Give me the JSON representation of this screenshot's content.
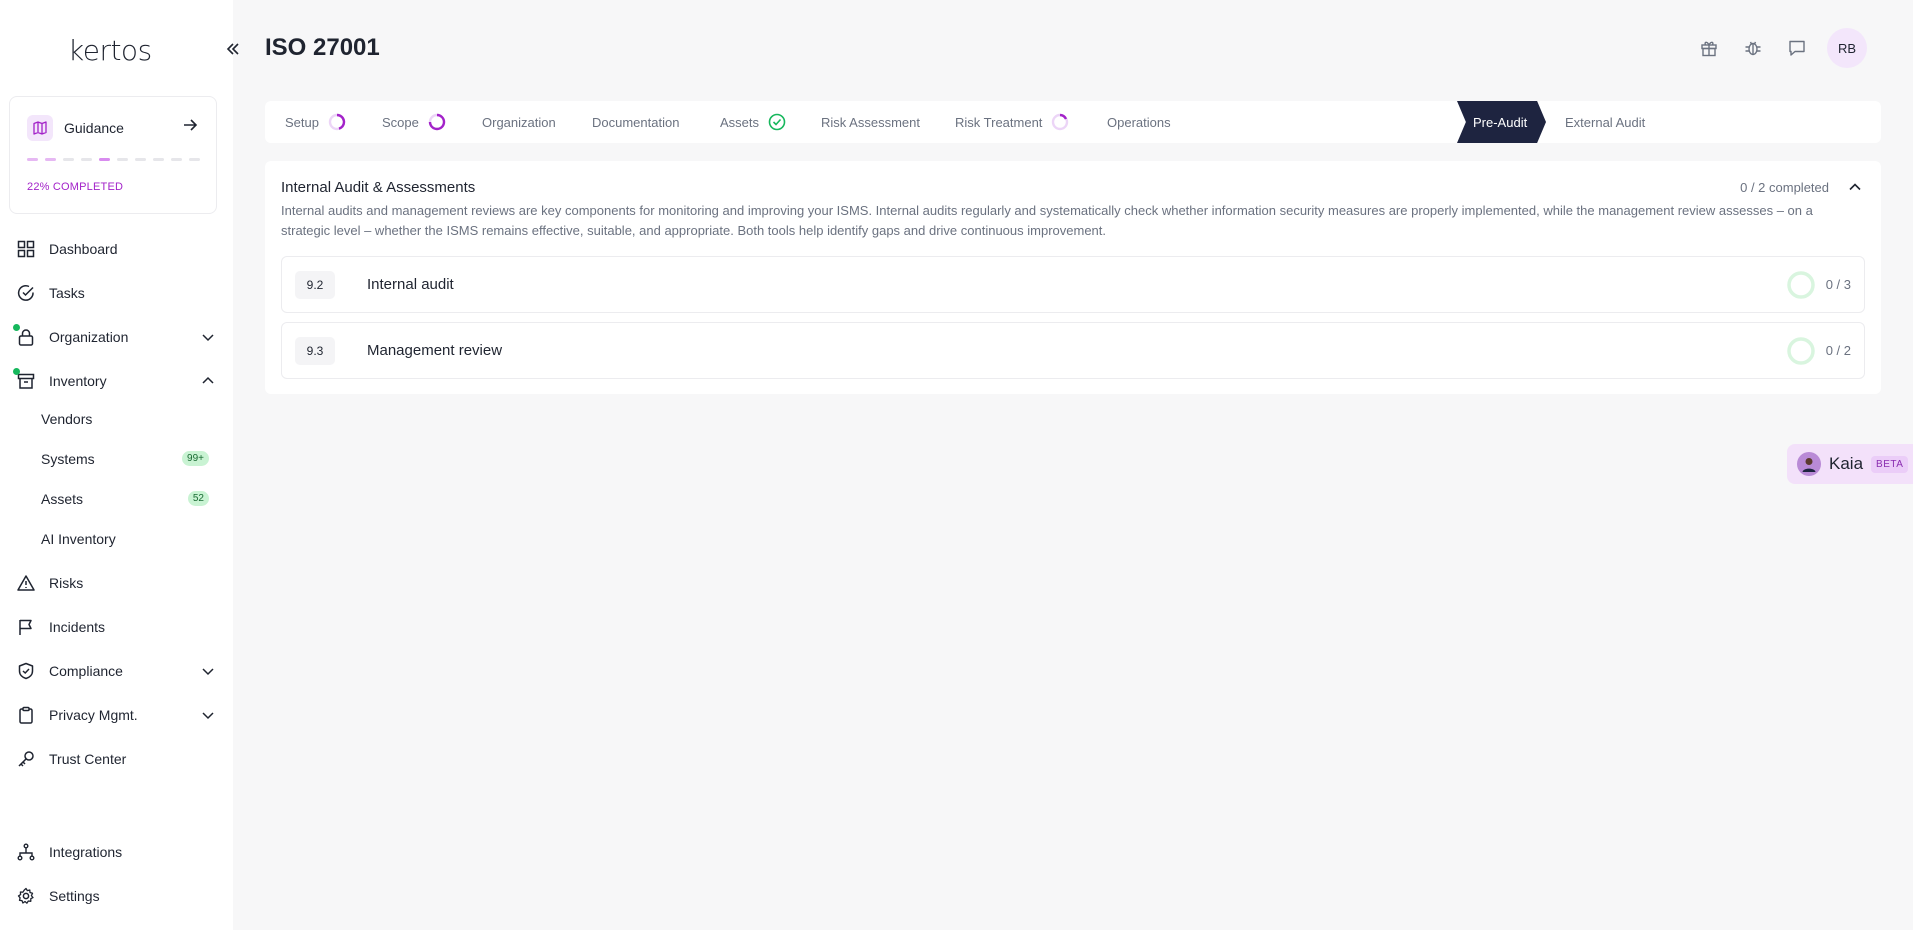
{
  "app": {
    "logo_text": "kertos",
    "page_title": "ISO 27001"
  },
  "sidebar": {
    "guidance": {
      "label": "Guidance",
      "progress_text": "22% COMPLETED",
      "progress_fraction": 0.22
    },
    "items": [
      {
        "label": "Dashboard",
        "icon": "grid-icon"
      },
      {
        "label": "Tasks",
        "icon": "check-circle-icon"
      },
      {
        "label": "Organization",
        "icon": "lock-icon",
        "has_dot": true,
        "expandable": true,
        "expanded": false
      },
      {
        "label": "Inventory",
        "icon": "archive-icon",
        "has_dot": true,
        "expandable": true,
        "expanded": true
      },
      {
        "label": "Risks",
        "icon": "warning-icon"
      },
      {
        "label": "Incidents",
        "icon": "flag-icon"
      },
      {
        "label": "Compliance",
        "icon": "shield-check-icon",
        "expandable": true,
        "expanded": false
      },
      {
        "label": "Privacy Mgmt.",
        "icon": "clipboard-icon",
        "expandable": true,
        "expanded": false
      },
      {
        "label": "Trust Center",
        "icon": "key-icon"
      },
      {
        "label": "Integrations",
        "icon": "network-icon"
      },
      {
        "label": "Settings",
        "icon": "gear-icon"
      }
    ],
    "inventory_sub": [
      {
        "label": "Vendors",
        "badge": ""
      },
      {
        "label": "Systems",
        "badge": "99+"
      },
      {
        "label": "Assets",
        "badge": "52"
      },
      {
        "label": "AI Inventory",
        "badge": ""
      }
    ]
  },
  "header": {
    "icons": [
      "gift-icon",
      "bug-icon",
      "chat-icon"
    ],
    "avatar_initials": "RB"
  },
  "stepper": {
    "steps": [
      {
        "label": "Setup",
        "status": "in-progress"
      },
      {
        "label": "Scope",
        "status": "in-progress"
      },
      {
        "label": "Organization",
        "status": "none"
      },
      {
        "label": "Documentation",
        "status": "none"
      },
      {
        "label": "Assets",
        "status": "done"
      },
      {
        "label": "Risk Assessment",
        "status": "none"
      },
      {
        "label": "Risk Treatment",
        "status": "in-progress"
      },
      {
        "label": "Operations",
        "status": "none"
      },
      {
        "label": "Pre-Audit",
        "status": "active"
      },
      {
        "label": "External Audit",
        "status": "none"
      }
    ]
  },
  "section": {
    "title": "Internal Audit & Assessments",
    "count_text": "0 / 2 completed",
    "description": "Internal audits and management reviews are key components for monitoring and improving your ISMS. Internal audits regularly and systematically check whether information security measures are properly implemented, while the management review assesses – on a strategic level – whether the ISMS remains effective, suitable, and appropriate. Both tools help identify gaps and drive continuous improvement.",
    "requirements": [
      {
        "code": "9.2",
        "name": "Internal audit",
        "progress": "0 / 3"
      },
      {
        "code": "9.3",
        "name": "Management review",
        "progress": "0 / 2"
      }
    ]
  },
  "kaia": {
    "name": "Kaia",
    "badge": "BETA"
  },
  "colors": {
    "accent": "#a323c9",
    "active_step": "#1e2440",
    "success": "#16b75c"
  }
}
